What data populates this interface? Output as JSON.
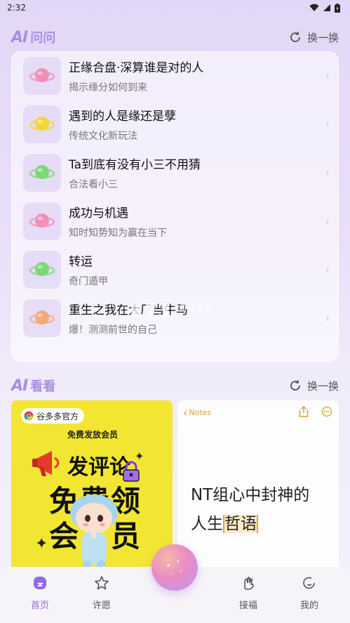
{
  "status": {
    "time": "2:32",
    "wifi_icon": "wifi-icon",
    "signal_icon": "signal-icon",
    "battery_icon": "battery-icon"
  },
  "ask_section": {
    "logo": "AI",
    "title": "问问",
    "refresh_label": "换一换"
  },
  "ask_items": [
    {
      "title": "正缘合盘·深算谁是对的人",
      "subtitle": "揭示缘分如何到来",
      "icon_color": "#f28fb6"
    },
    {
      "title": "遇到的人是缘还是孽",
      "subtitle": "传统文化新玩法",
      "icon_color": "#f3d63a"
    },
    {
      "title": "Ta到底有没有小三不用猜",
      "subtitle": "合法看小三",
      "icon_color": "#7fd878"
    },
    {
      "title": "成功与机遇",
      "subtitle": "知时知势知为赢在当下",
      "icon_color": "#f28fb6"
    },
    {
      "title": "转运",
      "subtitle": "奇门遁甲",
      "icon_color": "#7fd878"
    },
    {
      "title": "重生之我在大厂当牛马",
      "subtitle": "爆！测测前世的自己",
      "icon_color": "#f6a97c"
    }
  ],
  "look_section": {
    "logo": "AI",
    "title": "看看",
    "refresh_label": "换一换"
  },
  "left_card": {
    "tag": "谷多多官方",
    "line1": "免费发放会员",
    "line2": "发评论",
    "line3": "免费领",
    "line4": "会员"
  },
  "right_card": {
    "notes_label": "Notes",
    "headline_1": "NT组心中封神的",
    "headline_2": "人生",
    "headline_highlight": "哲语"
  },
  "watermark": {
    "text": "K73",
    "sub": "游戏之家"
  },
  "nav": [
    {
      "label": "首页",
      "icon": "home-icon",
      "active": true
    },
    {
      "label": "许愿",
      "icon": "star-icon",
      "active": false
    },
    {
      "label": "接福",
      "icon": "hand-icon",
      "active": false
    },
    {
      "label": "我的",
      "icon": "profile-icon",
      "active": false
    }
  ],
  "colors": {
    "accent": "#8f6bde",
    "logo": "#a88ee3",
    "yellow_card": "#f2e632"
  }
}
